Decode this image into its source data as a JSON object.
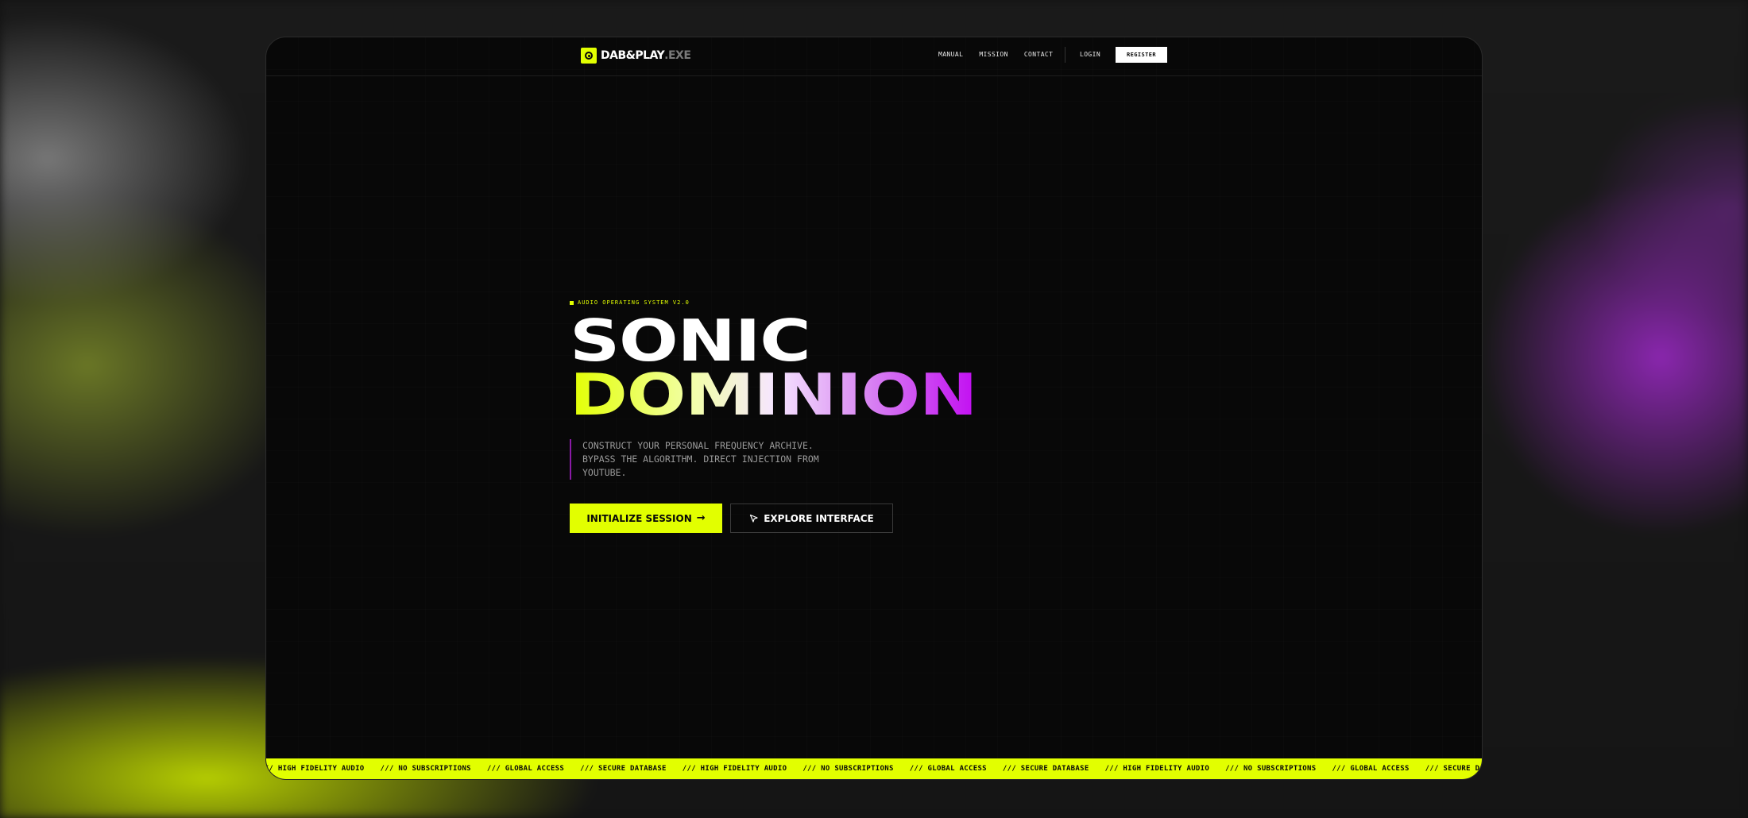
{
  "brand": {
    "name": "DAB&PLAY",
    "extension": ".EXE",
    "icon": "speaker-icon",
    "accent_color": "#e2ff00",
    "secondary_color": "#c20df2"
  },
  "nav": {
    "links": [
      "MANUAL",
      "MISSION",
      "CONTACT"
    ],
    "login_label": "LOGIN",
    "register_label": "REGISTER"
  },
  "hero": {
    "eyebrow": "AUDIO OPERATING SYSTEM V2.0",
    "title_line1": "SONIC",
    "title_line2": "DOMINION",
    "description": "CONSTRUCT YOUR PERSONAL FREQUENCY ARCHIVE. BYPASS THE ALGORITHM. DIRECT INJECTION FROM YOUTUBE.",
    "primary_cta": "INITIALIZE SESSION",
    "primary_cta_icon": "arrow-right-icon",
    "secondary_cta": "EXPLORE INTERFACE",
    "secondary_cta_icon": "cursor-icon"
  },
  "ticker": {
    "items": [
      "/// HIGH FIDELITY AUDIO",
      "/// NO SUBSCRIPTIONS",
      "/// GLOBAL ACCESS",
      "/// SECURE DATABASE",
      "/// HIGH FIDELITY AUDIO",
      "/// NO SUBSCRIPTIONS",
      "/// GLOBAL ACCESS",
      "/// SECURE DATABASE",
      "/// HIGH FIDELITY AUDIO",
      "/// NO SUBSCRIPTIONS",
      "/// GLOBAL ACCESS",
      "/// SECURE DATABASE"
    ]
  }
}
